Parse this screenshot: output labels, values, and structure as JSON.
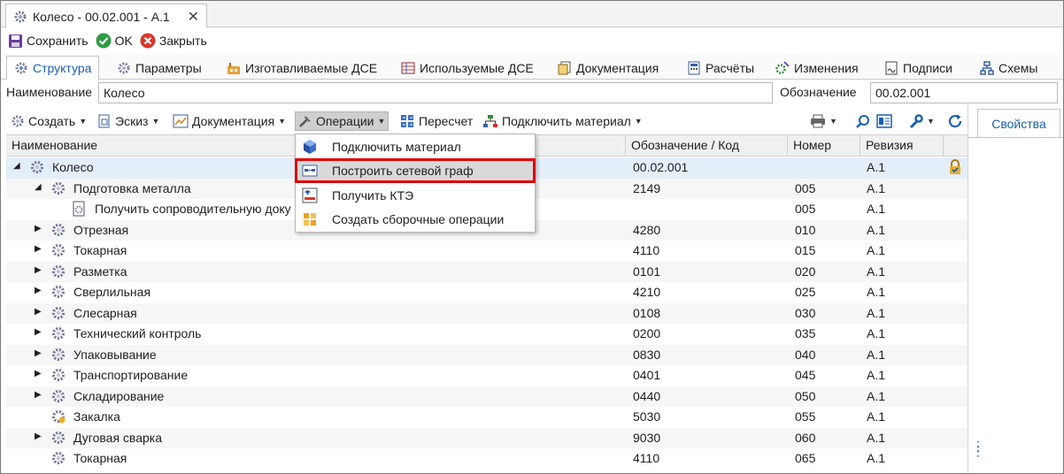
{
  "window": {
    "tab_title": "Колесо - 00.02.001 - А.1",
    "close_glyph": "✕"
  },
  "save_bar": {
    "save": "Сохранить",
    "ok": "OK",
    "close": "Закрыть"
  },
  "tabs": [
    {
      "label": "Структура",
      "icon": "structure-icon"
    },
    {
      "label": "Параметры",
      "icon": "gear-icon"
    },
    {
      "label": "Изготавливаемые ДСЕ",
      "icon": "factory-icon"
    },
    {
      "label": "Используемые ДСЕ",
      "icon": "table-icon"
    },
    {
      "label": "Документация",
      "icon": "documents-icon"
    },
    {
      "label": "Расчёты",
      "icon": "calculator-icon"
    },
    {
      "label": "Изменения",
      "icon": "changes-icon"
    },
    {
      "label": "Подписи",
      "icon": "signature-icon"
    },
    {
      "label": "Схемы",
      "icon": "scheme-icon"
    }
  ],
  "fields": {
    "name_label": "Наименование",
    "name_value": "Колесо",
    "code_label": "Обозначение",
    "code_value": "00.02.001"
  },
  "toolbar": {
    "create": "Создать",
    "sketch": "Эскиз",
    "docs": "Документация",
    "operations": "Операции",
    "recalc": "Пересчет",
    "attach_material": "Подключить материал"
  },
  "right_panel": {
    "properties": "Свойства"
  },
  "grid": {
    "columns": [
      "Наименование",
      "Обозначение / Код",
      "Номер",
      "Ревизия"
    ],
    "rows": [
      {
        "name": "Колесо",
        "code": "00.02.001",
        "num": "",
        "rev": "А.1",
        "level": 0,
        "toggle": "◢",
        "icon": "gear-icon",
        "locked": true
      },
      {
        "name": "Подготовка металла",
        "code": "2149",
        "num": "005",
        "rev": "А.1",
        "level": 1,
        "toggle": "◢",
        "icon": "gear-icon"
      },
      {
        "name": "Получить сопроводительную доку",
        "code": "",
        "num": "005",
        "rev": "А.1",
        "level": 2,
        "toggle": "",
        "icon": "document-icon"
      },
      {
        "name": "Отрезная",
        "code": "4280",
        "num": "010",
        "rev": "А.1",
        "level": 1,
        "toggle": "▶",
        "icon": "gear-icon"
      },
      {
        "name": "Токарная",
        "code": "4110",
        "num": "015",
        "rev": "А.1",
        "level": 1,
        "toggle": "▶",
        "icon": "gear-icon"
      },
      {
        "name": "Разметка",
        "code": "0101",
        "num": "020",
        "rev": "А.1",
        "level": 1,
        "toggle": "▶",
        "icon": "gear-icon"
      },
      {
        "name": "Сверлильная",
        "code": "4210",
        "num": "025",
        "rev": "А.1",
        "level": 1,
        "toggle": "▶",
        "icon": "gear-icon"
      },
      {
        "name": "Слесарная",
        "code": "0108",
        "num": "030",
        "rev": "А.1",
        "level": 1,
        "toggle": "▶",
        "icon": "gear-icon"
      },
      {
        "name": "Технический контроль",
        "code": "0200",
        "num": "035",
        "rev": "А.1",
        "level": 1,
        "toggle": "▶",
        "icon": "gear-icon"
      },
      {
        "name": "Упаковывание",
        "code": "0830",
        "num": "040",
        "rev": "А.1",
        "level": 1,
        "toggle": "▶",
        "icon": "gear-icon"
      },
      {
        "name": "Транспортирование",
        "code": "0401",
        "num": "045",
        "rev": "А.1",
        "level": 1,
        "toggle": "▶",
        "icon": "gear-icon"
      },
      {
        "name": "Складирование",
        "code": "0440",
        "num": "050",
        "rev": "А.1",
        "level": 1,
        "toggle": "▶",
        "icon": "gear-icon"
      },
      {
        "name": "Закалка",
        "code": "5030",
        "num": "055",
        "rev": "А.1",
        "level": 1,
        "toggle": "",
        "icon": "gear-star-icon"
      },
      {
        "name": "Дуговая сварка",
        "code": "9030",
        "num": "060",
        "rev": "А.1",
        "level": 1,
        "toggle": "▶",
        "icon": "gear-icon"
      },
      {
        "name": "Токарная",
        "code": "4110",
        "num": "065",
        "rev": "А.1",
        "level": 1,
        "toggle": "",
        "icon": "gear-icon"
      }
    ]
  },
  "menu": {
    "items": [
      {
        "label": "Подключить материал",
        "icon": "cube-icon",
        "highlighted": false
      },
      {
        "label": "Построить сетевой граф",
        "icon": "network-graph-icon",
        "highlighted": true
      },
      {
        "label": "Получить КТЭ",
        "icon": "kte-icon",
        "highlighted": false
      },
      {
        "label": "Создать сборочные операции",
        "icon": "assembly-ops-icon",
        "highlighted": false
      }
    ]
  },
  "colors": {
    "accent": "#1a5fb4",
    "highlight_border": "#e00000",
    "selected_row": "#e4eef9"
  }
}
